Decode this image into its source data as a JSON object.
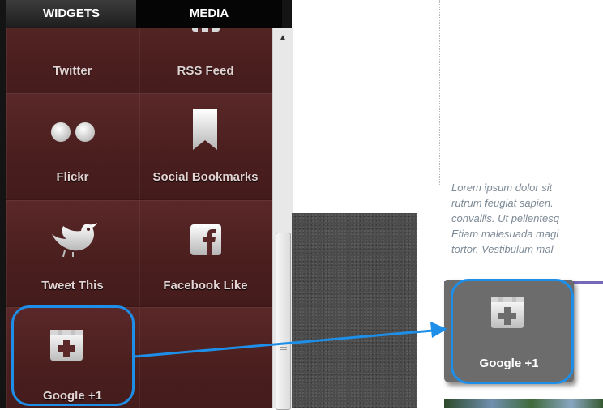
{
  "tabs": [
    {
      "label": "WIDGETS",
      "active": true
    },
    {
      "label": "MEDIA",
      "active": false
    }
  ],
  "widgets": [
    {
      "label": "Twitter",
      "icon": "twitter-icon"
    },
    {
      "label": "RSS Feed",
      "icon": "rss-feed-icon"
    },
    {
      "label": "Flickr",
      "icon": "flickr-icon"
    },
    {
      "label": "Social Bookmarks",
      "icon": "bookmark-icon"
    },
    {
      "label": "Tweet This",
      "icon": "bird-icon"
    },
    {
      "label": "Facebook Like",
      "icon": "facebook-icon"
    },
    {
      "label": "Google +1",
      "icon": "google-plus-one-icon"
    }
  ],
  "dropped_widget": {
    "label": "Google +1",
    "icon": "google-plus-one-icon"
  },
  "lorem_lines": [
    "Lorem ipsum dolor sit",
    "rutrum feugiat sapien.",
    "convallis. Ut pellentesq",
    "Etiam malesuada magi",
    "tortor. Vestibulum mal"
  ],
  "colors": {
    "highlight": "#1e8fe8",
    "panel": "#4c2020",
    "divider": "#7768b8"
  }
}
